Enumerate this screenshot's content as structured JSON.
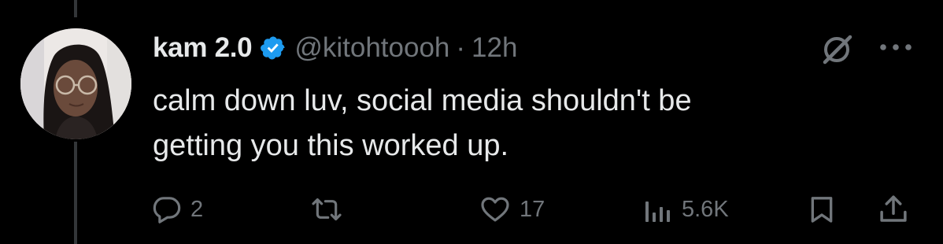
{
  "theme": {
    "background": "#000000",
    "text": "#e7e9ea",
    "muted": "#71767b",
    "verified_blue": "#1d9bf0"
  },
  "tweet": {
    "author": {
      "display_name": "kam 2.0",
      "handle": "@kitohtoooh",
      "verified": true,
      "avatar_icon": "profile-photo"
    },
    "separator": "·",
    "timestamp": "12h",
    "text_lines": [
      "calm down luv, social media shouldn't be",
      "getting you this worked up."
    ]
  },
  "top_actions": [
    {
      "name": "grok-icon"
    },
    {
      "name": "more-icon"
    }
  ],
  "actions": {
    "reply": {
      "icon": "reply-icon",
      "count": "2"
    },
    "retweet": {
      "icon": "retweet-icon",
      "count": ""
    },
    "like": {
      "icon": "heart-icon",
      "count": "17"
    },
    "views": {
      "icon": "views-icon",
      "count": "5.6K"
    },
    "bookmark": {
      "icon": "bookmark-icon"
    },
    "share": {
      "icon": "share-icon"
    }
  }
}
